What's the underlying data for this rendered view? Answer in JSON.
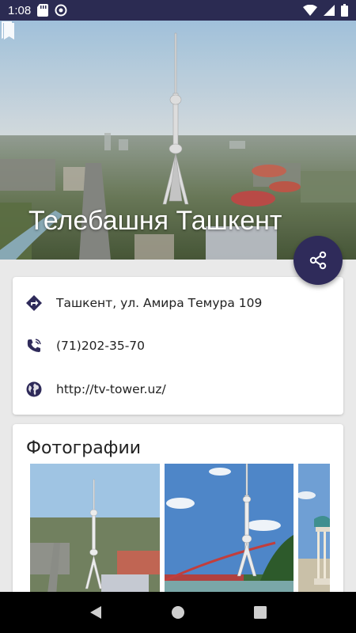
{
  "status_bar": {
    "time": "1:08"
  },
  "hero": {
    "title": "Телебашня Ташкент"
  },
  "info": {
    "address": "Ташкент, ул. Амира Темура 109",
    "phone": "(71)202-35-70",
    "website": "http://tv-tower.uz/"
  },
  "photos": {
    "title": "Фотографии",
    "count_visible": 3
  },
  "colors": {
    "primary": "#2f2b5a",
    "status_bar": "#2b2b52",
    "nav_bar": "#000000"
  }
}
